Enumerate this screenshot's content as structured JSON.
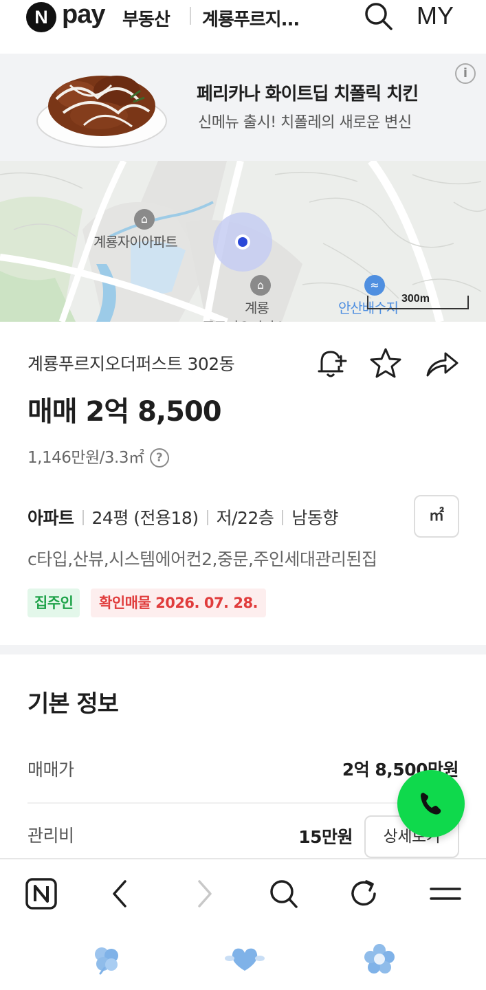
{
  "header": {
    "logo_n": "N",
    "logo_pay": "pay",
    "service": "부동산",
    "title": "계룡푸르지...",
    "my_label": "MY"
  },
  "ad": {
    "title": "페리카나 화이트딥 치폴릭 치킨",
    "subtitle": "신메뉴 출시! 치폴레의 새로운 변신",
    "info_glyph": "i"
  },
  "map": {
    "labels": {
      "apt1": "계룡자이아파트",
      "apt2": "계룡",
      "apt2_cut": "푸르지오더퍼스트",
      "reservoir": "안산배수지"
    },
    "scale": "300m"
  },
  "listing": {
    "complex_name": "계룡푸르지오더퍼스트 302동",
    "price": "매매 2억 8,500",
    "unit_price": "1,146만원/3.3㎡",
    "help_glyph": "?",
    "type": "아파트",
    "size": "24평 (전용18)",
    "floor": "저/22층",
    "direction": "남동향",
    "unit_toggle": "㎡",
    "description": "c타입,산뷰,시스템에어컨2,중문,주인세대관리된집",
    "badge_owner": "집주인",
    "badge_verified": "확인매물 2026. 07. 28."
  },
  "basic_info": {
    "title": "기본 정보",
    "rows": [
      {
        "label": "매매가",
        "value": "2억 8,500만원"
      },
      {
        "label": "관리비",
        "value": "15만원",
        "button": "상세보기"
      }
    ]
  },
  "colors": {
    "accent_green": "#0fd94c",
    "owner_green": "#1fa34a",
    "verified_red": "#e03c3c",
    "map_marker": "#2a48d8"
  },
  "icons": {
    "header": [
      "search-icon"
    ],
    "actions": [
      "bell-plus-icon",
      "star-icon",
      "share-icon"
    ],
    "browser": [
      "naver-home-icon",
      "back-icon",
      "forward-icon",
      "search-icon",
      "refresh-icon",
      "menu-icon"
    ],
    "dock": [
      "clover-icon",
      "heart-icon",
      "flower-icon"
    ]
  }
}
